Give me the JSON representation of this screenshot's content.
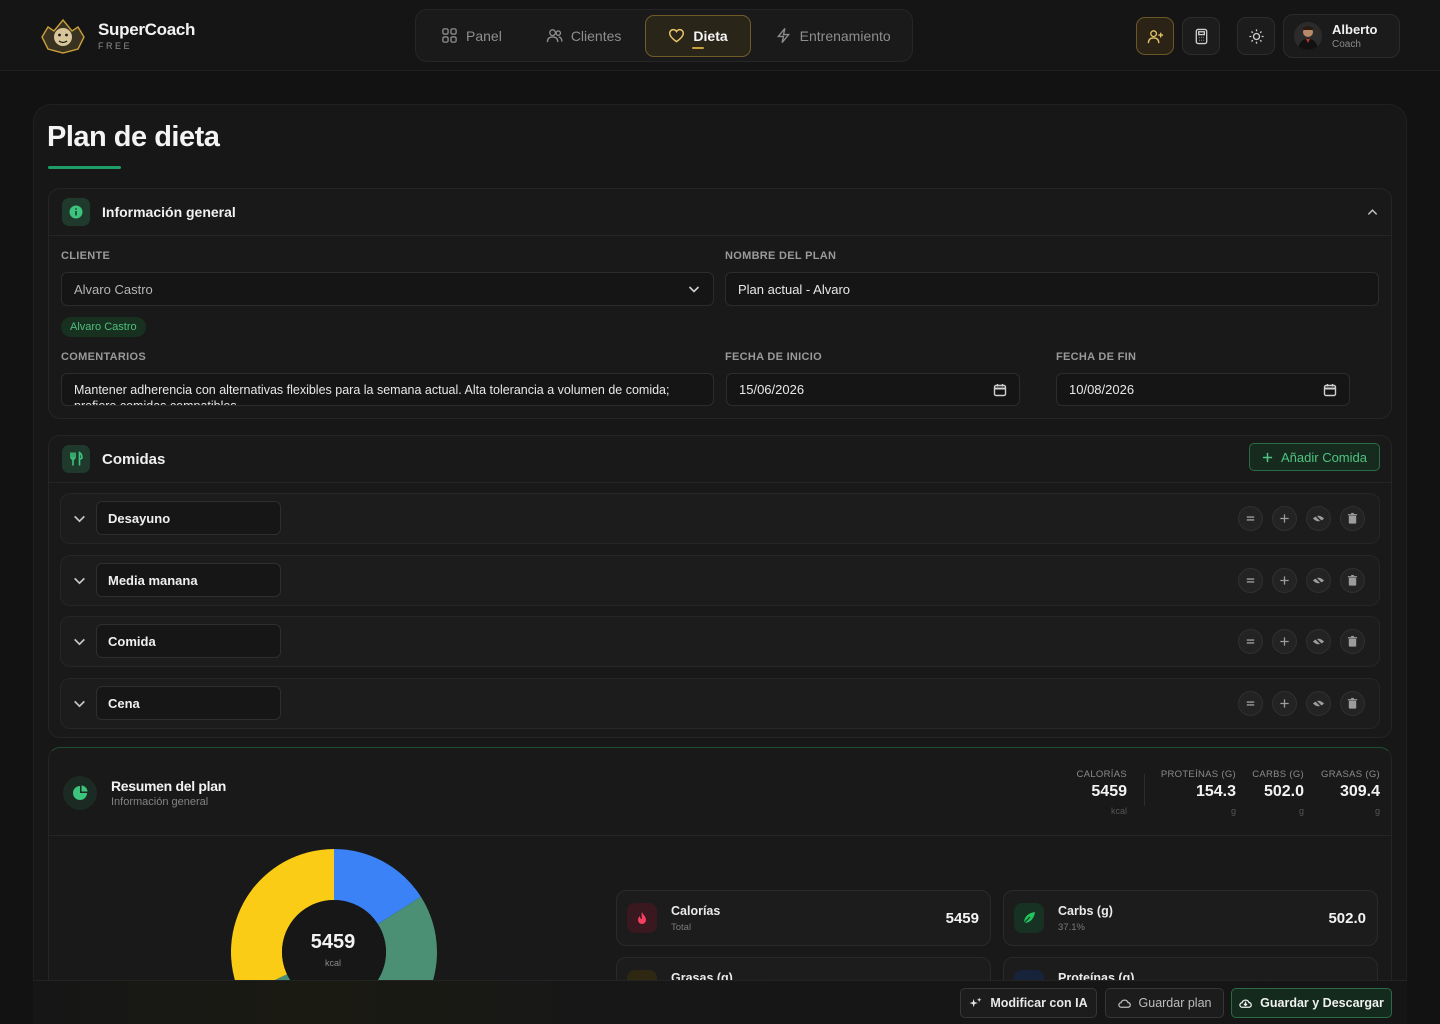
{
  "brand": {
    "name": "SuperCoach",
    "tier": "FREE"
  },
  "nav": {
    "tabs": [
      {
        "label": "Panel",
        "icon": "grid-icon",
        "active": false
      },
      {
        "label": "Clientes",
        "icon": "users-icon",
        "active": false
      },
      {
        "label": "Dieta",
        "icon": "heart-icon",
        "active": true
      },
      {
        "label": "Entrenamiento",
        "icon": "bolt-icon",
        "active": false
      }
    ]
  },
  "header_actions": [
    "add-user-icon",
    "calculator-icon",
    "sun-icon"
  ],
  "user": {
    "name": "Alberto",
    "role": "Coach"
  },
  "page": {
    "title": "Plan de dieta"
  },
  "general_info": {
    "title": "Información general",
    "client_label": "CLIENTE",
    "client_value": "Alvaro Castro",
    "client_chip": "Alvaro Castro",
    "plan_name_label": "NOMBRE DEL PLAN",
    "plan_name_value": "Plan actual - Alvaro",
    "comments_label": "COMENTARIOS",
    "comments_value": "Mantener adherencia con alternativas flexibles para la semana actual. Alta tolerancia a volumen de comida; prefiere comidas compatibles.",
    "start_date_label": "FECHA DE INICIO",
    "start_date_value": "15/06/2026",
    "end_date_label": "FECHA DE FIN",
    "end_date_value": "10/08/2026"
  },
  "meals": {
    "title": "Comidas",
    "add_label": "Añadir Comida",
    "items": [
      {
        "name": "Desayuno"
      },
      {
        "name": "Media manana"
      },
      {
        "name": "Comida"
      },
      {
        "name": "Cena"
      }
    ]
  },
  "summary": {
    "title": "Resumen del plan",
    "subtitle": "Información general",
    "stats": [
      {
        "label": "CALORÍAS",
        "value": "5459",
        "unit": "kcal"
      },
      {
        "label": "PROTEÍNAS (G)",
        "value": "154.3",
        "unit": "g"
      },
      {
        "label": "CARBS (G)",
        "value": "502.0",
        "unit": "g"
      },
      {
        "label": "GRASAS (G)",
        "value": "309.4",
        "unit": "g"
      }
    ],
    "donut": {
      "center_value": "5459",
      "center_unit": "kcal",
      "segments": [
        {
          "label": "Proteínas",
          "value": 154.3,
          "color": "#3b82f6"
        },
        {
          "label": "Carbs",
          "value": 502.0,
          "color": "#4b8f75"
        },
        {
          "label": "Grasas",
          "value": 309.4,
          "color": "#facc15"
        }
      ]
    },
    "macro_cards": [
      {
        "name": "Calorías",
        "sub": "Total",
        "value": "5459",
        "icon": "flame-icon",
        "color": "#f43f5e"
      },
      {
        "name": "Carbs (g)",
        "sub": "37.1%",
        "value": "502.0",
        "icon": "leaf-icon",
        "color": "#22c55e"
      },
      {
        "name": "Grasas (g)",
        "sub": "",
        "value": "",
        "icon": "drop-icon",
        "color": "#eab308"
      },
      {
        "name": "Proteínas (g)",
        "sub": "",
        "value": "",
        "icon": "dumbbell-icon",
        "color": "#3b82f6"
      }
    ]
  },
  "footer": {
    "ai_label": "Modificar con IA",
    "save_label": "Guardar plan",
    "save_download_label": "Guardar y Descargar"
  },
  "colors": {
    "accent": "#1f9d67",
    "gold": "#c9a13b",
    "background": "#121212"
  }
}
